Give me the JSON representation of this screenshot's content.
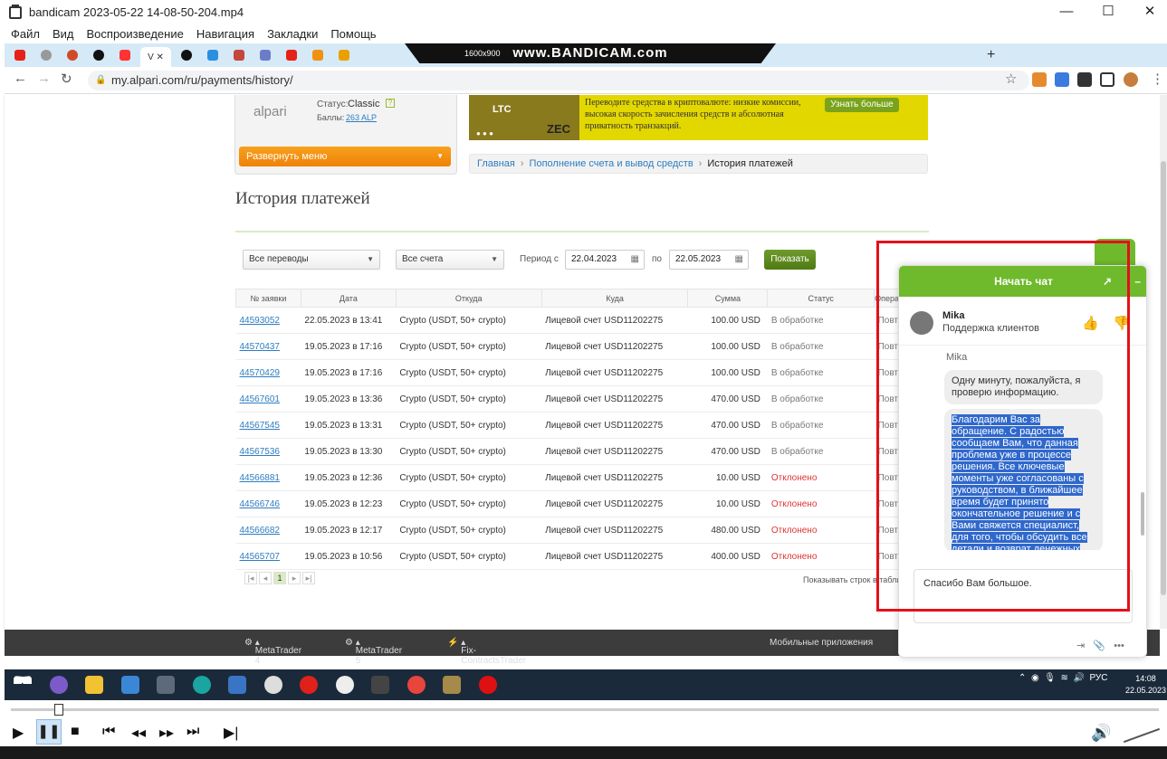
{
  "player": {
    "title": "bandicam 2023-05-22 14-08-50-204.mp4",
    "menu": [
      "Файл",
      "Вид",
      "Воспроизведение",
      "Навигация",
      "Закладки",
      "Помощь"
    ],
    "win_min": "—",
    "win_max": "☐",
    "win_close": "✕"
  },
  "browser": {
    "url": "my.alpari.com/ru/payments/history/",
    "bandicam_label": "www.BANDICAM.com",
    "bandicam_res": "1600x900",
    "active_tab": "V",
    "tab_close": "✕",
    "new_tab": "+"
  },
  "page": {
    "status_label": "Статус:",
    "status_value": "Classic",
    "points_label": "Баллы:",
    "points_value": "263 ALP",
    "logo": "alpari",
    "expand_menu": "Развернуть меню",
    "banner_text": "Переводите средства в криптовалюте: низкие комиссии, высокая скорость зачисления средств и абсолютная приватность транзакций.",
    "banner_btn": "Узнать больше",
    "banner_coin1": "LTC",
    "banner_coin2": "ZEC",
    "crumbs": [
      "Главная",
      "Пополнение счета и вывод средств",
      "История платежей"
    ],
    "heading": "История платежей"
  },
  "filters": {
    "transfers": "Все переводы",
    "accounts": "Все счета",
    "period_label": "Период с",
    "date_from": "22.04.2023",
    "to_label": "по",
    "date_to": "22.05.2023",
    "show_btn": "Показать"
  },
  "table": {
    "headers": [
      "№ заявки",
      "Дата",
      "Откуда",
      "Куда",
      "Сумма",
      "Статус",
      "Опера"
    ],
    "rows": [
      {
        "id": "44593052",
        "date": "22.05.2023 в 13:41",
        "from": "Crypto (USDT, 50+ crypto)",
        "to": "Лицевой счет USD11202275",
        "sum": "100.00 USD",
        "status": "В обработке",
        "op": "Повто"
      },
      {
        "id": "44570437",
        "date": "19.05.2023 в 17:16",
        "from": "Crypto (USDT, 50+ crypto)",
        "to": "Лицевой счет USD11202275",
        "sum": "100.00 USD",
        "status": "В обработке",
        "op": "Повто"
      },
      {
        "id": "44570429",
        "date": "19.05.2023 в 17:16",
        "from": "Crypto (USDT, 50+ crypto)",
        "to": "Лицевой счет USD11202275",
        "sum": "100.00 USD",
        "status": "В обработке",
        "op": "Повто"
      },
      {
        "id": "44567601",
        "date": "19.05.2023 в 13:36",
        "from": "Crypto (USDT, 50+ crypto)",
        "to": "Лицевой счет USD11202275",
        "sum": "470.00 USD",
        "status": "В обработке",
        "op": "Повто"
      },
      {
        "id": "44567545",
        "date": "19.05.2023 в 13:31",
        "from": "Crypto (USDT, 50+ crypto)",
        "to": "Лицевой счет USD11202275",
        "sum": "470.00 USD",
        "status": "В обработке",
        "op": "Повто"
      },
      {
        "id": "44567536",
        "date": "19.05.2023 в 13:30",
        "from": "Crypto (USDT, 50+ crypto)",
        "to": "Лицевой счет USD11202275",
        "sum": "470.00 USD",
        "status": "В обработке",
        "op": "Повто"
      },
      {
        "id": "44566881",
        "date": "19.05.2023 в 12:36",
        "from": "Crypto (USDT, 50+ crypto)",
        "to": "Лицевой счет USD11202275",
        "sum": "10.00 USD",
        "status": "Отклонено",
        "op": "Повто"
      },
      {
        "id": "44566746",
        "date": "19.05.2023 в 12:23",
        "from": "Crypto (USDT, 50+ crypto)",
        "to": "Лицевой счет USD11202275",
        "sum": "10.00 USD",
        "status": "Отклонено",
        "op": "Повто"
      },
      {
        "id": "44566682",
        "date": "19.05.2023 в 12:17",
        "from": "Crypto (USDT, 50+ crypto)",
        "to": "Лицевой счет USD11202275",
        "sum": "480.00 USD",
        "status": "Отклонено",
        "op": "Повто"
      },
      {
        "id": "44565707",
        "date": "19.05.2023 в 10:56",
        "from": "Crypto (USDT, 50+ crypto)",
        "to": "Лицевой счет USD11202275",
        "sum": "400.00 USD",
        "status": "Отклонено",
        "op": "Повто"
      }
    ],
    "page": "1",
    "per_page": "Показывать строк в табли"
  },
  "footer": {
    "mt4": "MetaTrader 4",
    "mt5": "MetaTrader 5",
    "fix": "Fix-ContractsTrader",
    "mobile": "Мобильные приложения"
  },
  "chat": {
    "header": "Начать чат",
    "agent_name": "Mika",
    "agent_role": "Поддержка клиентов",
    "msg_author": "Mika",
    "msg1": "Одну минуту, пожалуйста, я проверю информацию.",
    "msg2": "Благодарим Вас за обращение.  С радостью сообщаем Вам, что данная проблема уже в процессе решения. Все ключевые моменты уже согласованы с руководством, в ближайшее время будет принято окончательное решение и с Вами свяжется специалист, для того, чтобы обсудить все детали и возврат денежных",
    "input": "Спасибо Вам большое."
  },
  "taskbar": {
    "lang": "РУС",
    "time": "14:08",
    "date": "22.05.2023"
  },
  "colors": {
    "accent_green": "#6fba2c",
    "orange": "#f29111",
    "highlight": "#2f68cc",
    "red_box": "#e3101a"
  }
}
